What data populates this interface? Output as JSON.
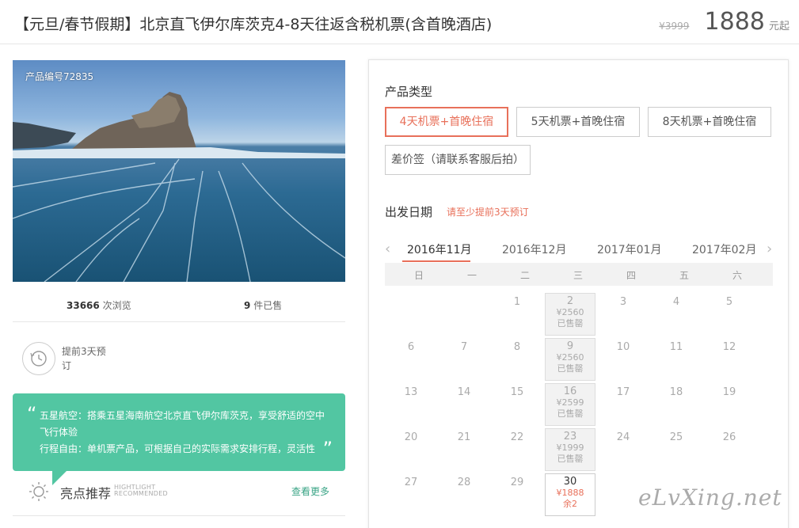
{
  "header": {
    "title": "【元旦/春节假期】北京直飞伊尔库茨克4-8天往返含税机票(含首晚酒店)",
    "old_price": "¥3999",
    "price": "1888",
    "price_unit": "元起"
  },
  "photo": {
    "product_no": "产品编号72835"
  },
  "stats": {
    "views_count": "33666",
    "views_label": "次浏览",
    "sold_count": "9",
    "sold_label": "件已售"
  },
  "booking_tip": {
    "text": "提前3天预订"
  },
  "highlight": {
    "quote_open": "“",
    "quote_close": "”",
    "line1": "五星航空：搭乘五星海南航空北京直飞伊尔库茨克，享受舒适的空中飞行体验",
    "line2": "行程自由：单机票产品，可根据自己的实际需求安排行程，灵活性",
    "title": "亮点推荐",
    "en_line1": "HIGHTLIGHT",
    "en_line2": "RECOMMENDED",
    "more": "查看更多"
  },
  "product_type": {
    "label": "产品类型",
    "options": [
      "4天机票+首晚住宿",
      "5天机票+首晚住宿",
      "8天机票+首晚住宿",
      "差价签（请联系客服后拍）"
    ],
    "selected_index": 0
  },
  "departure": {
    "label": "出发日期",
    "note": "请至少提前3天预订",
    "prev_arrow": "‹",
    "next_arrow": "›",
    "months": [
      "2016年11月",
      "2016年12月",
      "2017年01月",
      "2017年02月"
    ],
    "active_month_index": 0,
    "weekdays": [
      "日",
      "一",
      "二",
      "三",
      "四",
      "五",
      "六"
    ],
    "days": [
      {
        "day": "1",
        "col": 2,
        "row": 0
      },
      {
        "day": "2",
        "col": 3,
        "row": 0,
        "status": "sold",
        "price": "¥2560",
        "note": "已售罄"
      },
      {
        "day": "3",
        "col": 4,
        "row": 0
      },
      {
        "day": "4",
        "col": 5,
        "row": 0
      },
      {
        "day": "5",
        "col": 6,
        "row": 0
      },
      {
        "day": "6",
        "col": 0,
        "row": 1
      },
      {
        "day": "7",
        "col": 1,
        "row": 1
      },
      {
        "day": "8",
        "col": 2,
        "row": 1
      },
      {
        "day": "9",
        "col": 3,
        "row": 1,
        "status": "sold",
        "price": "¥2560",
        "note": "已售罄"
      },
      {
        "day": "10",
        "col": 4,
        "row": 1
      },
      {
        "day": "11",
        "col": 5,
        "row": 1
      },
      {
        "day": "12",
        "col": 6,
        "row": 1
      },
      {
        "day": "13",
        "col": 0,
        "row": 2
      },
      {
        "day": "14",
        "col": 1,
        "row": 2
      },
      {
        "day": "15",
        "col": 2,
        "row": 2
      },
      {
        "day": "16",
        "col": 3,
        "row": 2,
        "status": "sold",
        "price": "¥2599",
        "note": "已售罄"
      },
      {
        "day": "17",
        "col": 4,
        "row": 2
      },
      {
        "day": "18",
        "col": 5,
        "row": 2
      },
      {
        "day": "19",
        "col": 6,
        "row": 2
      },
      {
        "day": "20",
        "col": 0,
        "row": 3
      },
      {
        "day": "21",
        "col": 1,
        "row": 3
      },
      {
        "day": "22",
        "col": 2,
        "row": 3
      },
      {
        "day": "23",
        "col": 3,
        "row": 3,
        "status": "sold",
        "price": "¥1999",
        "note": "已售罄"
      },
      {
        "day": "24",
        "col": 4,
        "row": 3
      },
      {
        "day": "25",
        "col": 5,
        "row": 3
      },
      {
        "day": "26",
        "col": 6,
        "row": 3
      },
      {
        "day": "27",
        "col": 0,
        "row": 4
      },
      {
        "day": "28",
        "col": 1,
        "row": 4
      },
      {
        "day": "29",
        "col": 2,
        "row": 4
      },
      {
        "day": "30",
        "col": 3,
        "row": 4,
        "status": "available",
        "price": "¥1888",
        "note": "余2"
      }
    ]
  },
  "watermark": "eLvXing.net",
  "colors": {
    "accent": "#e8705a",
    "highlight_bg": "#52c6a2",
    "more_link": "#3aa486"
  }
}
